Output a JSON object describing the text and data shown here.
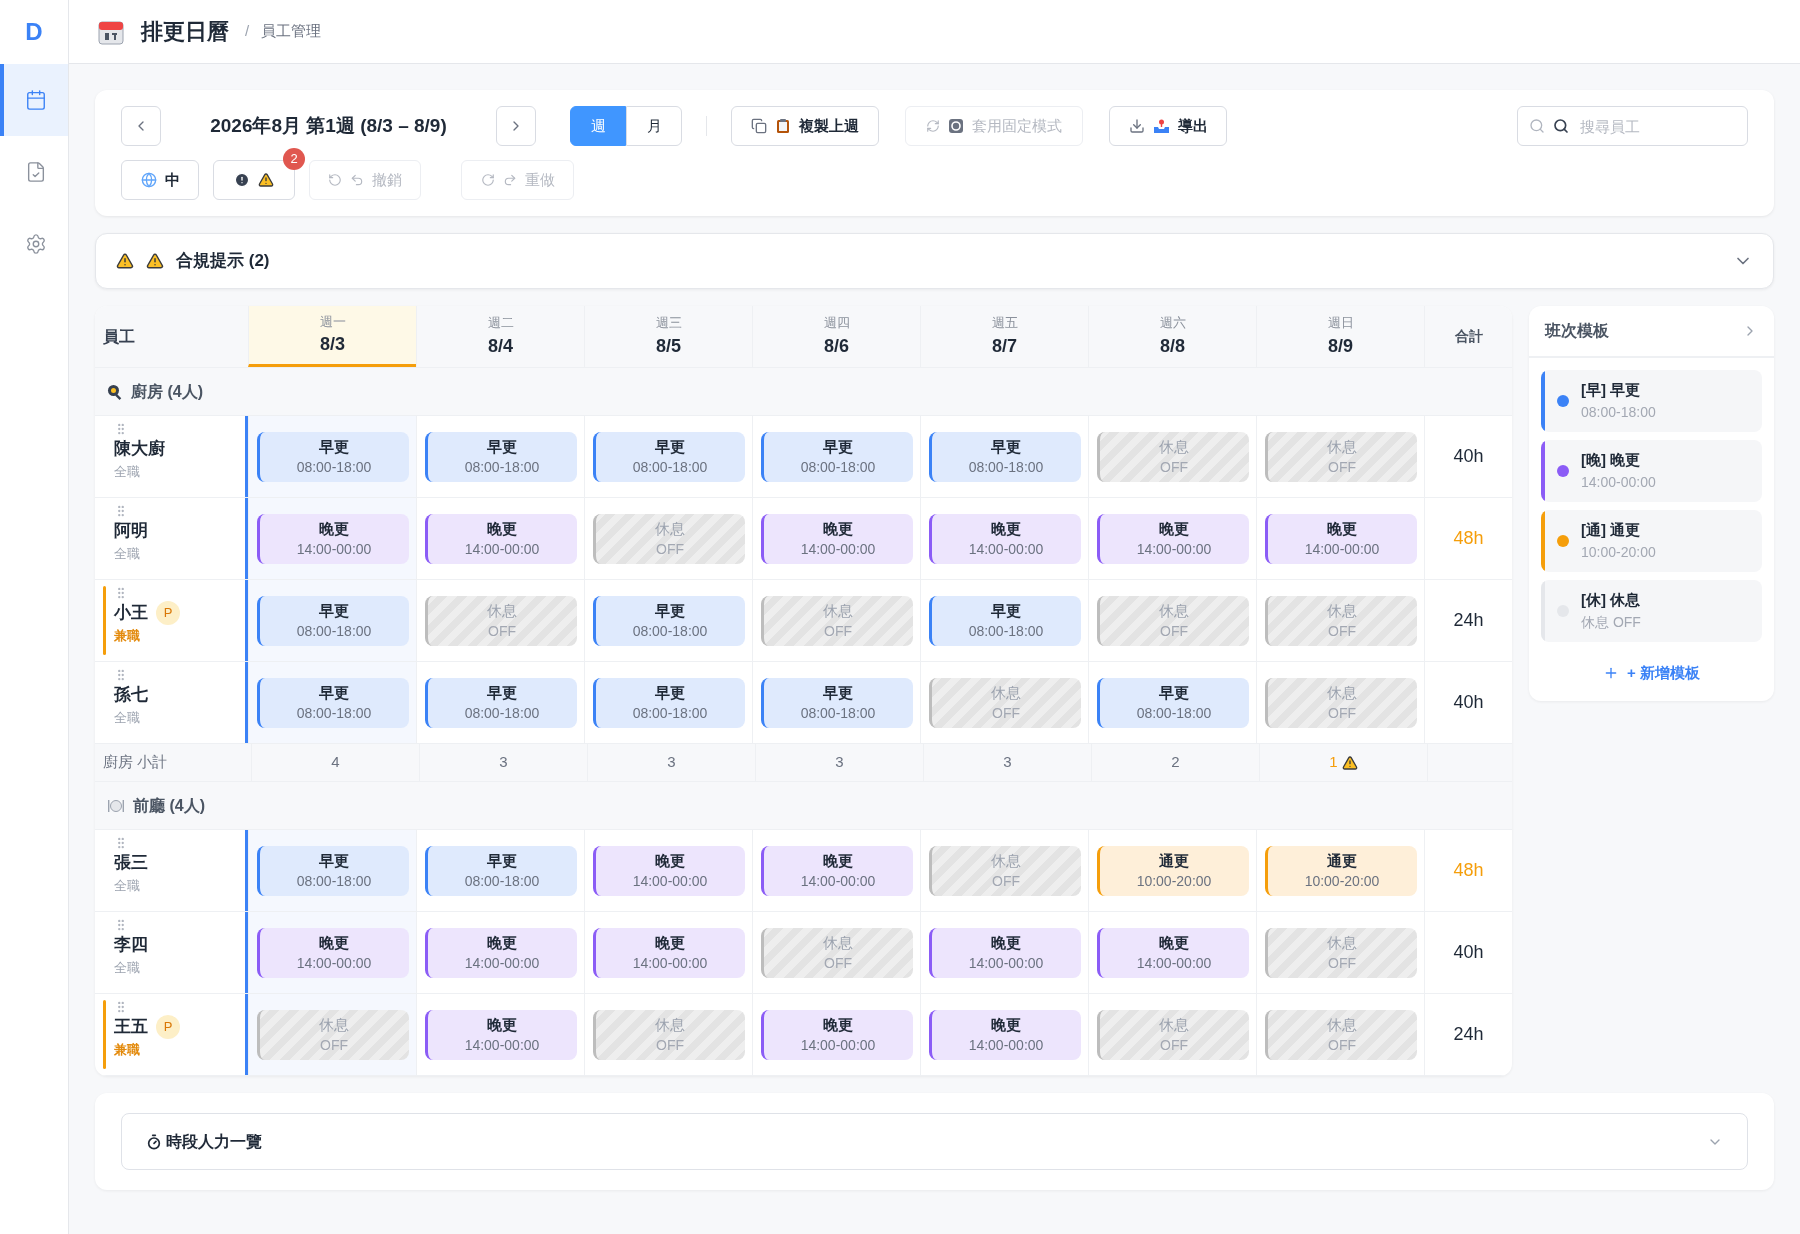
{
  "sidebar": {
    "logo": "D",
    "items": [
      {
        "selected": true
      },
      {
        "selected": false
      },
      {
        "selected": false
      }
    ]
  },
  "header": {
    "title": "排更日曆",
    "separator": "/",
    "breadcrumb": "員工管理"
  },
  "toolbar": {
    "period": "2026年8月 第1週 (8/3 – 8/9)",
    "view_tabs": [
      {
        "label": "週",
        "selected": true
      },
      {
        "label": "月",
        "selected": false
      }
    ],
    "copy_button": {
      "label": "複製上週",
      "disabled": false
    },
    "pattern_button": {
      "label": "套用固定模式",
      "disabled": true
    },
    "export_button": {
      "label": "導出",
      "disabled": false
    },
    "search": {
      "placeholder": "搜尋員工"
    },
    "language_button": {
      "label": "中"
    },
    "alerts_button": {
      "badge": "2"
    },
    "undo_button": {
      "label": "撤銷",
      "disabled": true
    },
    "redo_button": {
      "label": "重做",
      "disabled": true
    }
  },
  "compliance": {
    "title": "合規提示 (2)",
    "expanded": false
  },
  "table": {
    "employee_column": "員工",
    "total_column": "合計",
    "days": [
      {
        "weekday": "週一",
        "date": "8/3",
        "selected": true
      },
      {
        "weekday": "週二",
        "date": "8/4",
        "selected": false
      },
      {
        "weekday": "週三",
        "date": "8/5",
        "selected": false
      },
      {
        "weekday": "週四",
        "date": "8/6",
        "selected": false
      },
      {
        "weekday": "週五",
        "date": "8/7",
        "selected": false
      },
      {
        "weekday": "週六",
        "date": "8/8",
        "selected": false
      },
      {
        "weekday": "週日",
        "date": "8/9",
        "selected": false
      }
    ],
    "groups": [
      {
        "name": "廚房 (4人)",
        "employees": [
          {
            "name": "陳大廚",
            "type": "全職",
            "part_time": false,
            "total": "40h",
            "over": false,
            "shifts": [
              {
                "kind": "early",
                "label": "早更",
                "time": "08:00-18:00"
              },
              {
                "kind": "early",
                "label": "早更",
                "time": "08:00-18:00"
              },
              {
                "kind": "early",
                "label": "早更",
                "time": "08:00-18:00"
              },
              {
                "kind": "early",
                "label": "早更",
                "time": "08:00-18:00"
              },
              {
                "kind": "early",
                "label": "早更",
                "time": "08:00-18:00"
              },
              {
                "kind": "off",
                "label": "休息",
                "time": "OFF"
              },
              {
                "kind": "off",
                "label": "休息",
                "time": "OFF"
              }
            ]
          },
          {
            "name": "阿明",
            "type": "全職",
            "part_time": false,
            "total": "48h",
            "over": true,
            "shifts": [
              {
                "kind": "late",
                "label": "晚更",
                "time": "14:00-00:00"
              },
              {
                "kind": "late",
                "label": "晚更",
                "time": "14:00-00:00"
              },
              {
                "kind": "off",
                "label": "休息",
                "time": "OFF"
              },
              {
                "kind": "late",
                "label": "晚更",
                "time": "14:00-00:00"
              },
              {
                "kind": "late",
                "label": "晚更",
                "time": "14:00-00:00"
              },
              {
                "kind": "late",
                "label": "晚更",
                "time": "14:00-00:00"
              },
              {
                "kind": "late",
                "label": "晚更",
                "time": "14:00-00:00"
              }
            ]
          },
          {
            "name": "小王",
            "type": "兼職",
            "part_time": true,
            "badge": "P",
            "total": "24h",
            "over": false,
            "shifts": [
              {
                "kind": "early",
                "label": "早更",
                "time": "08:00-18:00"
              },
              {
                "kind": "off",
                "label": "休息",
                "time": "OFF"
              },
              {
                "kind": "early",
                "label": "早更",
                "time": "08:00-18:00"
              },
              {
                "kind": "off",
                "label": "休息",
                "time": "OFF"
              },
              {
                "kind": "early",
                "label": "早更",
                "time": "08:00-18:00"
              },
              {
                "kind": "off",
                "label": "休息",
                "time": "OFF"
              },
              {
                "kind": "off",
                "label": "休息",
                "time": "OFF"
              }
            ]
          },
          {
            "name": "孫七",
            "type": "全職",
            "part_time": false,
            "total": "40h",
            "over": false,
            "shifts": [
              {
                "kind": "early",
                "label": "早更",
                "time": "08:00-18:00"
              },
              {
                "kind": "early",
                "label": "早更",
                "time": "08:00-18:00"
              },
              {
                "kind": "early",
                "label": "早更",
                "time": "08:00-18:00"
              },
              {
                "kind": "early",
                "label": "早更",
                "time": "08:00-18:00"
              },
              {
                "kind": "off",
                "label": "休息",
                "time": "OFF"
              },
              {
                "kind": "early",
                "label": "早更",
                "time": "08:00-18:00"
              },
              {
                "kind": "off",
                "label": "休息",
                "time": "OFF"
              }
            ]
          }
        ],
        "subtotal": {
          "label": "廚房 小計",
          "values": [
            {
              "text": "4",
              "warning": false
            },
            {
              "text": "3",
              "warning": false
            },
            {
              "text": "3",
              "warning": false
            },
            {
              "text": "3",
              "warning": false
            },
            {
              "text": "3",
              "warning": false
            },
            {
              "text": "2",
              "warning": false
            },
            {
              "text": "1",
              "warning": true
            }
          ]
        }
      },
      {
        "name": "前廳 (4人)",
        "employees": [
          {
            "name": "張三",
            "type": "全職",
            "part_time": false,
            "total": "48h",
            "over": true,
            "shifts": [
              {
                "kind": "early",
                "label": "早更",
                "time": "08:00-18:00"
              },
              {
                "kind": "early",
                "label": "早更",
                "time": "08:00-18:00"
              },
              {
                "kind": "late",
                "label": "晚更",
                "time": "14:00-00:00"
              },
              {
                "kind": "late",
                "label": "晚更",
                "time": "14:00-00:00"
              },
              {
                "kind": "off",
                "label": "休息",
                "time": "OFF"
              },
              {
                "kind": "regular",
                "label": "通更",
                "time": "10:00-20:00"
              },
              {
                "kind": "regular",
                "label": "通更",
                "time": "10:00-20:00"
              }
            ]
          },
          {
            "name": "李四",
            "type": "全職",
            "part_time": false,
            "total": "40h",
            "over": false,
            "shifts": [
              {
                "kind": "late",
                "label": "晚更",
                "time": "14:00-00:00"
              },
              {
                "kind": "late",
                "label": "晚更",
                "time": "14:00-00:00"
              },
              {
                "kind": "late",
                "label": "晚更",
                "time": "14:00-00:00"
              },
              {
                "kind": "off",
                "label": "休息",
                "time": "OFF"
              },
              {
                "kind": "late",
                "label": "晚更",
                "time": "14:00-00:00"
              },
              {
                "kind": "late",
                "label": "晚更",
                "time": "14:00-00:00"
              },
              {
                "kind": "off",
                "label": "休息",
                "time": "OFF"
              }
            ]
          },
          {
            "name": "王五",
            "type": "兼職",
            "part_time": true,
            "badge": "P",
            "total": "24h",
            "over": false,
            "shifts": [
              {
                "kind": "off",
                "label": "休息",
                "time": "OFF"
              },
              {
                "kind": "late",
                "label": "晚更",
                "time": "14:00-00:00"
              },
              {
                "kind": "off",
                "label": "休息",
                "time": "OFF"
              },
              {
                "kind": "late",
                "label": "晚更",
                "time": "14:00-00:00"
              },
              {
                "kind": "late",
                "label": "晚更",
                "time": "14:00-00:00"
              },
              {
                "kind": "off",
                "label": "休息",
                "time": "OFF"
              },
              {
                "kind": "off",
                "label": "休息",
                "time": "OFF"
              }
            ]
          }
        ]
      }
    ]
  },
  "templates": {
    "title": "班次模板",
    "items": [
      {
        "label": "[早] 早更",
        "time": "08:00-18:00",
        "color": "#3b82f6"
      },
      {
        "label": "[晚] 晚更",
        "time": "14:00-00:00",
        "color": "#8b5cf6"
      },
      {
        "label": "[通] 通更",
        "time": "10:00-20:00",
        "color": "#f59e0b"
      },
      {
        "label": "[休] 休息",
        "time": "休息 OFF",
        "color": "#e5e7eb"
      }
    ],
    "add_label": "+ 新增模板"
  },
  "staffing": {
    "title": "時段人力一覽",
    "expanded": false
  }
}
